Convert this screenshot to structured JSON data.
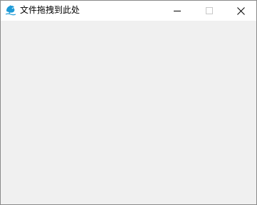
{
  "window": {
    "title": "文件拖拽到此处",
    "icon": "dolphin-app-icon",
    "colors": {
      "titlebar": "#ffffff",
      "client": "#f0f0f0",
      "border": "#8a8a8a",
      "icon_blue": "#1e9bd7"
    }
  },
  "controls": {
    "minimize_icon": "minimize-icon",
    "maximize_icon": "maximize-icon",
    "close_icon": "close-icon",
    "maximize_enabled": false
  }
}
